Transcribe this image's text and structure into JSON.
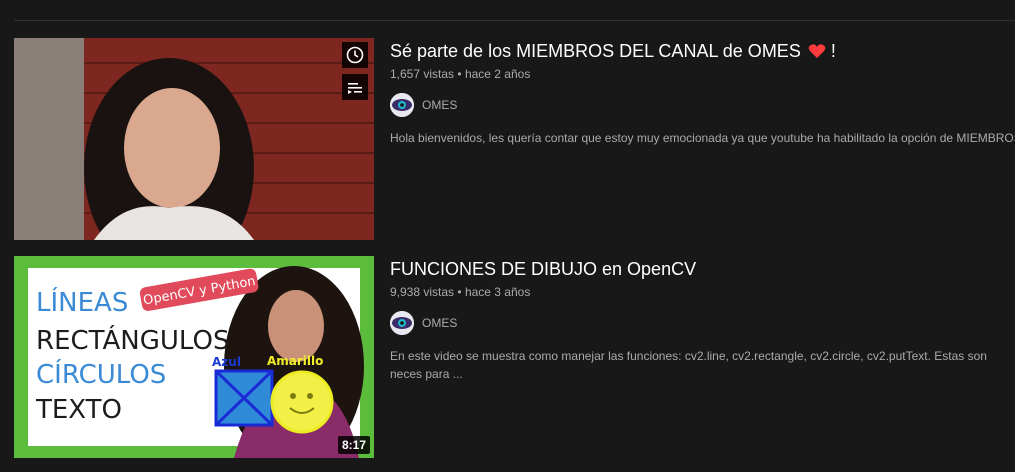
{
  "videos": [
    {
      "title": "Sé parte de los MIEMBROS DEL CANAL de OMES",
      "title_suffix": "!",
      "views": "1,657 vistas",
      "age": "hace 2 años",
      "channel": "OMES",
      "description": "Hola bienvenidos, les quería contar que estoy muy emocionada ya que youtube ha habilitado la opción de MIEMBROS"
    },
    {
      "title": "FUNCIONES DE DIBUJO en OpenCV",
      "views": "9,938 vistas",
      "age": "hace 3 años",
      "channel": "OMES",
      "description": "En este video se muestra como manejar las funciones: cv2.line, cv2.rectangle, cv2.circle, cv2.putText. Estas son neces para ...",
      "duration": "8:17",
      "thumb_text": {
        "line1": "LÍNEAS",
        "line2": "RECTÁNGULOS",
        "line3": "CÍRCULOS",
        "line4": "TEXTO",
        "badge": "OpenCV y Python",
        "azul": "Azul",
        "amarillo": "Amarillo"
      }
    }
  ],
  "separator": "•",
  "icons": {
    "watch_later": "clock-icon",
    "add_to_queue": "queue-icon",
    "heart": "heart-icon"
  },
  "colors": {
    "background": "#181818",
    "text": "#ffffff",
    "secondary": "#aaaaaa",
    "heart": "#ff3b3b",
    "thumb_green": "#5bbd3b"
  }
}
